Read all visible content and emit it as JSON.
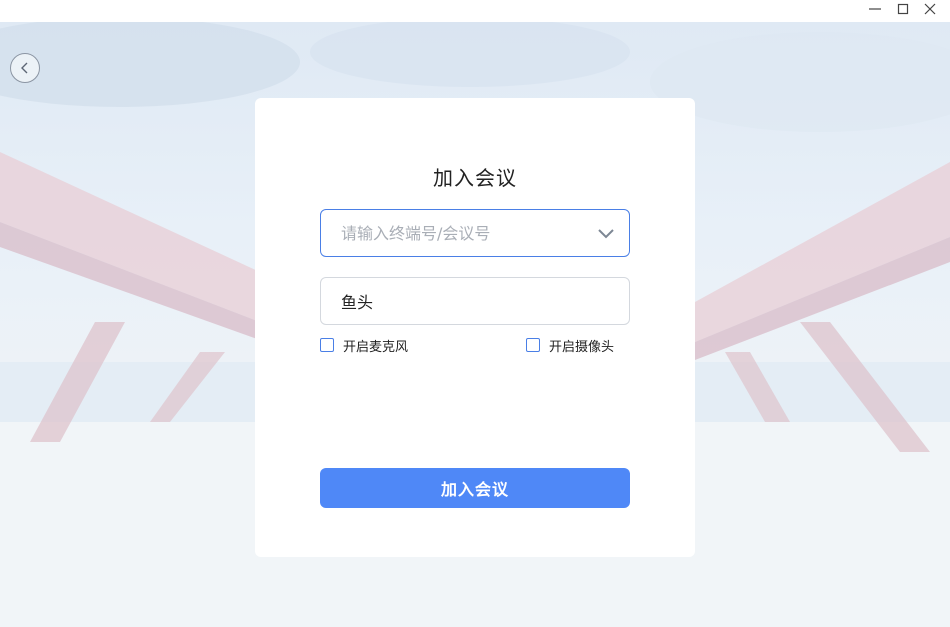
{
  "window_controls": {
    "minimize_icon": "minimize-icon",
    "maximize_icon": "maximize-icon",
    "close_icon": "close-icon"
  },
  "back_icon": "chevron-left-icon",
  "card": {
    "title": "加入会议",
    "meeting_input": {
      "placeholder": "请输入终端号/会议号",
      "value": ""
    },
    "dropdown_icon": "chevron-down-icon",
    "name_input": {
      "value": "鱼头"
    },
    "mic_option": {
      "label": "开启麦克风",
      "checked": false
    },
    "camera_option": {
      "label": "开启摄像头",
      "checked": false
    },
    "join_button": "加入会议"
  },
  "colors": {
    "accent": "#4f88f7",
    "input_focus_border": "#4a7fe6",
    "input_border": "#d4d8de",
    "placeholder": "#a9aeb6",
    "text": "#222222"
  }
}
